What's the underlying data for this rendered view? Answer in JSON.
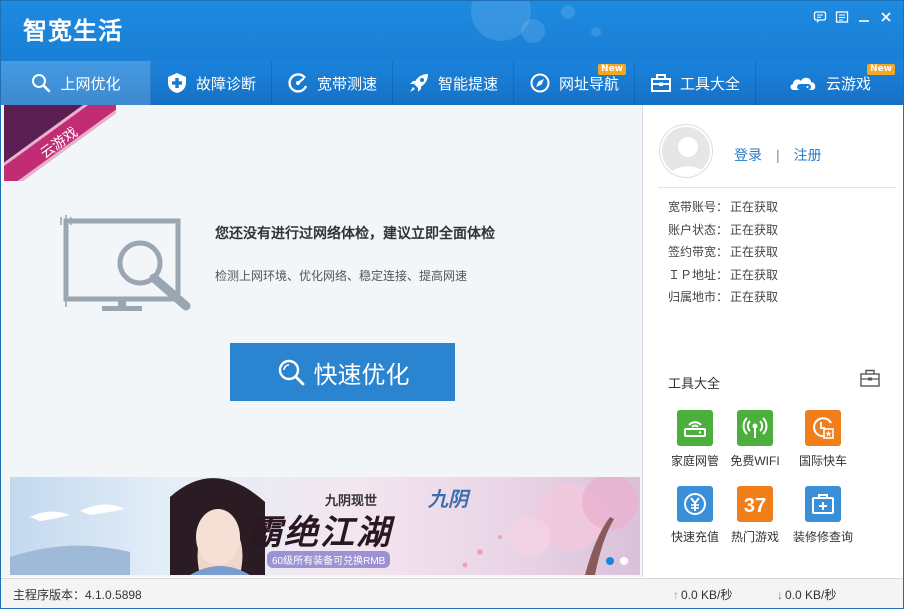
{
  "window": {
    "app_title": "智宽生活"
  },
  "nav": {
    "items": [
      {
        "label": "上网优化",
        "icon": "magnifier-icon",
        "active": true,
        "badge": ""
      },
      {
        "label": "故障诊断",
        "icon": "medical-cross-icon",
        "active": false,
        "badge": ""
      },
      {
        "label": "宽带测速",
        "icon": "speedometer-icon",
        "active": false,
        "badge": ""
      },
      {
        "label": "智能提速",
        "icon": "rocket-icon",
        "active": false,
        "badge": ""
      },
      {
        "label": "网址导航",
        "icon": "compass-icon",
        "active": false,
        "badge": "New"
      },
      {
        "label": "工具大全",
        "icon": "toolbox-icon",
        "active": false,
        "badge": ""
      },
      {
        "label": "云游戏",
        "icon": "cloud-gamepad-icon",
        "active": false,
        "badge": "New"
      }
    ]
  },
  "main": {
    "corner_ribbon": "云游戏",
    "check_title": "您还没有进行过网络体检，建议立即全面体检",
    "check_desc": "检测上网环境、优化网络、稳定连接、提高网速",
    "quick_button": "快速优化"
  },
  "banner": {
    "subtitle": "九阴现世",
    "title": "霸绝江湖",
    "logo": "九阴",
    "promo": "60级所有装备可兑换RMB"
  },
  "side": {
    "login": "登录",
    "separator": "|",
    "register": "注册",
    "info": [
      {
        "key": "宽带账号：",
        "value": "正在获取"
      },
      {
        "key": "账户状态：",
        "value": "正在获取"
      },
      {
        "key": "签约带宽：",
        "value": "正在获取"
      },
      {
        "key": "ＩＰ地址：",
        "value": "正在获取"
      },
      {
        "key": "归属地市：",
        "value": "正在获取"
      }
    ],
    "tools_title": "工具大全",
    "tools": [
      {
        "label": "家庭网管",
        "icon": "router-icon",
        "color": "#4cae3c"
      },
      {
        "label": "免费WIFI",
        "icon": "wifi-icon",
        "color": "#4cae3c"
      },
      {
        "label": "国际快车",
        "icon": "clock-star-icon",
        "color": "#f07f1b"
      },
      {
        "label": "快速充值",
        "icon": "yen-icon",
        "color": "#3a8fd9"
      },
      {
        "label": "热门游戏",
        "icon": "game-37-icon",
        "color": "#f07f1b"
      },
      {
        "label": "装修修查询",
        "icon": "toolbox-plus-icon",
        "color": "#3a8fd9"
      }
    ]
  },
  "status": {
    "version": "主程序版本：4.1.0.5898",
    "upload": "0.0 KB/秒",
    "download": "0.0 KB/秒"
  },
  "colors": {
    "brand_blue": "#1b84dd",
    "button_blue": "#2a84cf",
    "badge_orange": "#f7a621",
    "ribbon_pink": "#c12c74"
  }
}
